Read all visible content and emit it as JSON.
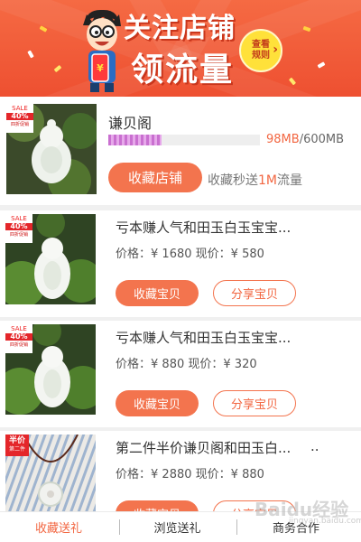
{
  "banner": {
    "line1": "关注店铺",
    "line2": "领流量",
    "rules_line1": "查看",
    "rules_line2": "规则",
    "phone_text": "¥"
  },
  "shop": {
    "name": "谦贝阁",
    "storage_used": "98MB",
    "storage_sep": "/",
    "storage_total": "600MB",
    "storage_progress": 0.35,
    "follow_button": "收藏店铺",
    "follow_note_prefix": "收藏秒送",
    "follow_note_highlight": "1M",
    "follow_note_suffix": "流量"
  },
  "sale_tag": {
    "top": "SALE",
    "percent": "40%",
    "bottom": "四折促销"
  },
  "half_tag": {
    "top": "半价",
    "bottom": "第二件"
  },
  "products": [
    {
      "title": "亏本赚人气和田玉白玉宝宝...",
      "price_label": "价格：",
      "price": "¥ 1680",
      "current_label": "现价：",
      "current": "¥ 580",
      "fav_button": "收藏宝贝",
      "share_button": "分享宝贝"
    },
    {
      "title": "亏本赚人气和田玉白玉宝宝...",
      "price_label": "价格：",
      "price": "¥ 880",
      "current_label": "现价：",
      "current": "¥ 320",
      "fav_button": "收藏宝贝",
      "share_button": "分享宝贝"
    },
    {
      "title": "第二件半价谦贝阁和田玉白...",
      "ellipsis": "..",
      "price_label": "价格：",
      "price": "¥ 2880",
      "current_label": "现价：",
      "current": "¥ 880",
      "fav_button": "收藏宝贝",
      "share_button": "分享宝贝"
    }
  ],
  "bottom_nav": {
    "items": [
      "收藏送礼",
      "浏览送礼",
      "商务合作"
    ],
    "active_index": 0
  },
  "watermark": {
    "text": "Baidu经验",
    "sub": "jingyan.baidu.com"
  },
  "colors": {
    "accent": "#f3744e",
    "banner": "#ee5031",
    "badge": "#ffe13a",
    "progress": "#c96fd0"
  }
}
